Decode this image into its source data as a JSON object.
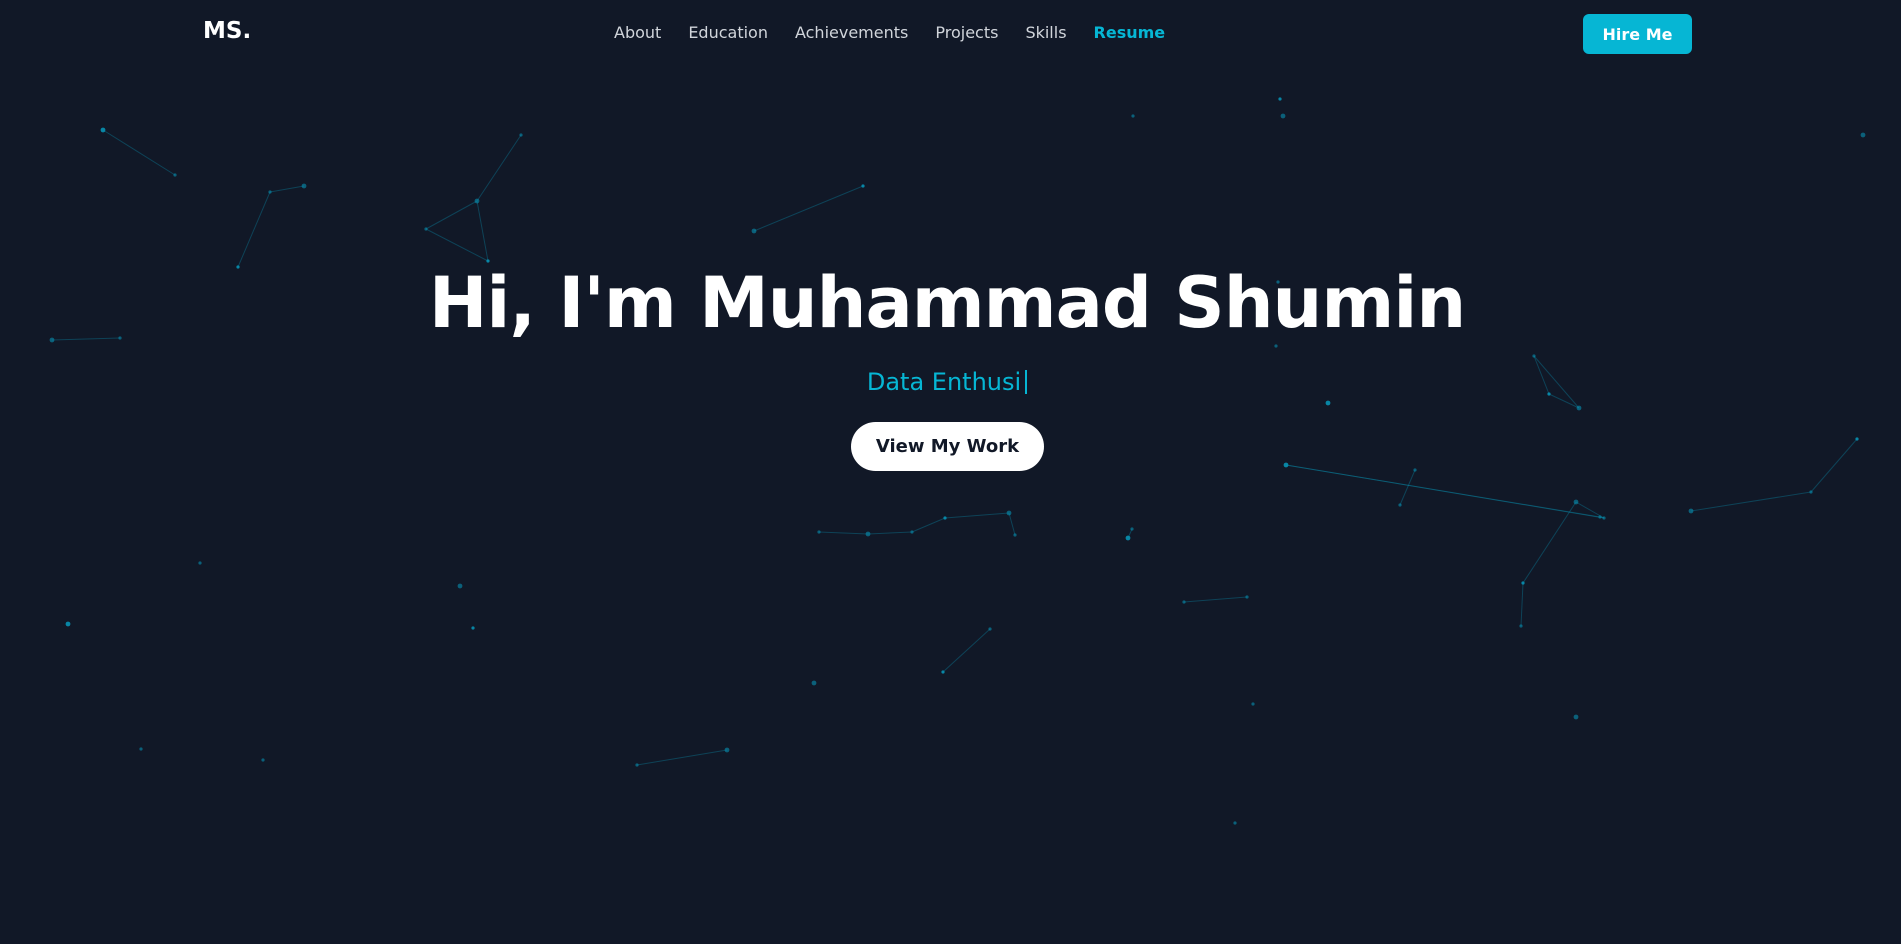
{
  "nav": {
    "logo": "MS.",
    "links": [
      {
        "label": "About"
      },
      {
        "label": "Education"
      },
      {
        "label": "Achievements"
      },
      {
        "label": "Projects"
      },
      {
        "label": "Skills"
      },
      {
        "label": "Resume",
        "active": true
      }
    ],
    "hire_label": "Hire Me"
  },
  "hero": {
    "title": "Hi, I'm Muhammad Shumin",
    "typed_text": "Data Enthusi",
    "cta_label": "View My Work"
  },
  "colors": {
    "background": "#111827",
    "accent": "#06b6d4",
    "particle": "#0891b2"
  }
}
